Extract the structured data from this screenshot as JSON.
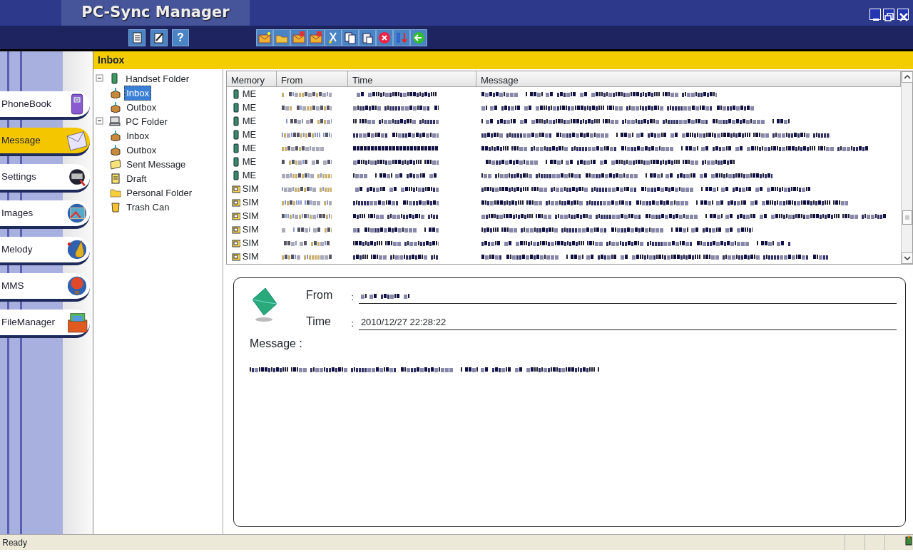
{
  "window": {
    "title": "PC-Sync Manager"
  },
  "nav": [
    {
      "label": "PhoneBook",
      "selected": false
    },
    {
      "label": "Message",
      "selected": true
    },
    {
      "label": "Settings",
      "selected": false
    },
    {
      "label": "Images",
      "selected": false
    },
    {
      "label": "Melody",
      "selected": false
    },
    {
      "label": "MMS",
      "selected": false
    },
    {
      "label": "FileManager",
      "selected": false
    }
  ],
  "toolbar": {
    "help": "?"
  },
  "folder_header": "Inbox",
  "tree": [
    {
      "label": "Handset Folder",
      "kind": "handset",
      "expanded": true,
      "selected": false,
      "children": [
        {
          "label": "Inbox",
          "kind": "box",
          "selected": true
        },
        {
          "label": "Outbox",
          "kind": "box",
          "selected": false
        }
      ]
    },
    {
      "label": "PC Folder",
      "kind": "pc",
      "expanded": true,
      "selected": false,
      "children": [
        {
          "label": "Inbox",
          "kind": "box",
          "selected": false
        },
        {
          "label": "Outbox",
          "kind": "box",
          "selected": false
        },
        {
          "label": "Sent Message",
          "kind": "sent",
          "selected": false
        },
        {
          "label": "Draft",
          "kind": "draft",
          "selected": false
        },
        {
          "label": "Personal Folder",
          "kind": "folder",
          "selected": false
        }
      ]
    },
    {
      "label": "Trash Can",
      "kind": "trash",
      "selected": false
    }
  ],
  "table": {
    "columns": [
      "Memory",
      "From",
      "Time",
      "Message"
    ],
    "rows": [
      {
        "memory": "ME",
        "kind": "phone"
      },
      {
        "memory": "ME",
        "kind": "phone"
      },
      {
        "memory": "ME",
        "kind": "phone"
      },
      {
        "memory": "ME",
        "kind": "phone"
      },
      {
        "memory": "ME",
        "kind": "phone"
      },
      {
        "memory": "ME",
        "kind": "phone"
      },
      {
        "memory": "ME",
        "kind": "phone"
      },
      {
        "memory": "SIM",
        "kind": "sim"
      },
      {
        "memory": "SIM",
        "kind": "sim"
      },
      {
        "memory": "SIM",
        "kind": "sim"
      },
      {
        "memory": "SIM",
        "kind": "sim"
      },
      {
        "memory": "SIM",
        "kind": "sim"
      },
      {
        "memory": "SIM",
        "kind": "sim"
      }
    ]
  },
  "detail": {
    "from_label": "From",
    "time_label": "Time",
    "time": "2010/12/27 22:28:22",
    "message_label": "Message :",
    "separator": ":"
  },
  "status_bar": {
    "text": "Ready"
  }
}
